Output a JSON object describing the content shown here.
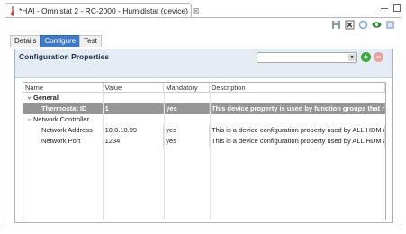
{
  "editor": {
    "tab_title": "*HAI - Omnistat 2 - RC-2000 - Humidistat (device)",
    "tab_close": "☒"
  },
  "page_tabs": [
    {
      "label": "Details",
      "active": false
    },
    {
      "label": "Configure",
      "active": true
    },
    {
      "label": "Test",
      "active": false
    }
  ],
  "panel": {
    "title": "Configuration Properties",
    "search_value": ""
  },
  "table": {
    "headers": [
      "Name",
      "Value",
      "Mandatory",
      "Description"
    ],
    "groups": [
      {
        "name": "General",
        "rows": [
          {
            "name": "Thermostat ID",
            "value": "1",
            "mandatory": "yes",
            "description": "This device property is used by function groups that need",
            "selected": true
          }
        ]
      },
      {
        "name": "Network Controller",
        "rows": [
          {
            "name": "Network Address",
            "value": "10.0.10.99",
            "mandatory": "yes",
            "description": "This is a device configuration property used by ALL HDM a",
            "selected": false
          },
          {
            "name": "Network Port",
            "value": "1234",
            "mandatory": "yes",
            "description": "This is a device configuration property used by ALL HDM a",
            "selected": false
          }
        ]
      }
    ]
  },
  "colors": {
    "active_tab": "#3f7ac8",
    "panel_header": "#e6ecf3",
    "selected_row": "#969696",
    "add_button": "#3aa83a",
    "remove_button": "#e7a3a3"
  },
  "icons": {
    "tab": "thermostat-icon",
    "toolbar": [
      "save-icon",
      "delete-icon",
      "refresh-icon",
      "view-icon",
      "info-icon"
    ],
    "panel": [
      "add-icon",
      "remove-icon",
      "dropdown-arrow-icon"
    ]
  }
}
